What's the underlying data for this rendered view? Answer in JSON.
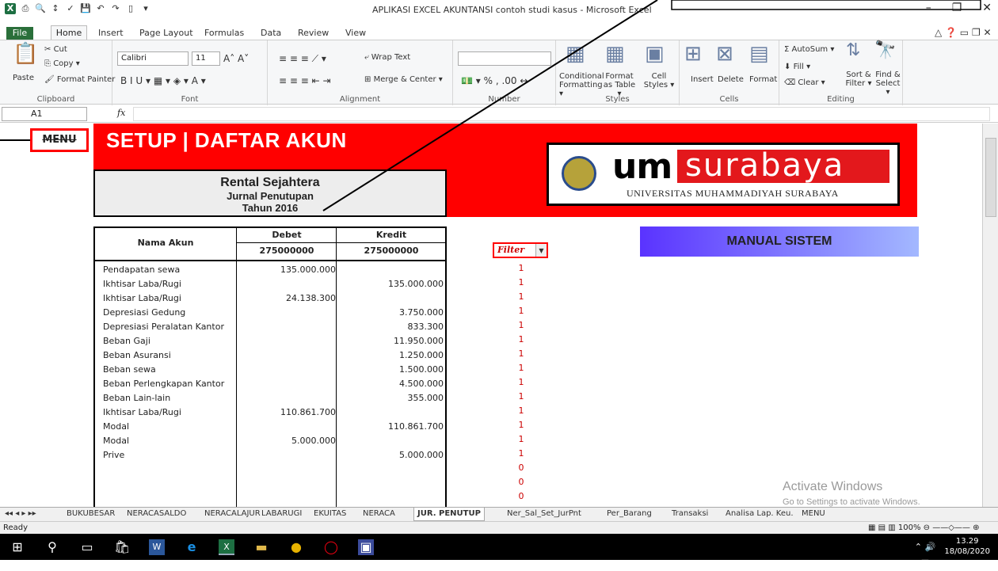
{
  "window": {
    "title": "APLIKASI EXCEL AKUNTANSI contoh studi kasus - Microsoft Excel",
    "controls": [
      "–",
      "❐",
      "✕"
    ]
  },
  "ribbon_tabs": [
    "File",
    "Home",
    "Insert",
    "Page Layout",
    "Formulas",
    "Data",
    "Review",
    "View"
  ],
  "ribbon": {
    "clipboard": {
      "paste": "Paste",
      "cut": "Cut",
      "copy": "Copy ▾",
      "format_painter": "Format Painter",
      "label": "Clipboard"
    },
    "font": {
      "name": "Calibri",
      "size": "11",
      "label": "Font"
    },
    "alignment": {
      "wrap": "Wrap Text",
      "merge": "Merge & Center ▾",
      "label": "Alignment"
    },
    "number": {
      "label": "Number",
      "percent": "%"
    },
    "styles": {
      "conditional": "Conditional Formatting ▾",
      "format_table": "Format as Table ▾",
      "cell_styles": "Cell Styles ▾",
      "label": "Styles"
    },
    "cells": {
      "insert": "Insert",
      "delete": "Delete",
      "format": "Format",
      "label": "Cells"
    },
    "editing": {
      "autosum": "Σ AutoSum ▾",
      "fill": "Fill ▾",
      "clear": "Clear ▾",
      "sort": "Sort & Filter ▾",
      "find": "Find & Select ▾",
      "label": "Editing"
    }
  },
  "formula_bar": {
    "cell_ref": "A1",
    "fx": "fx",
    "content": ""
  },
  "sheet": {
    "menu_button": "MENU",
    "title": "SETUP | DAFTAR AKUN",
    "company": "Rental Sejahtera",
    "subtitle": "Jurnal Penutupan",
    "year": "Tahun 2016",
    "logo": {
      "um": "um",
      "surabaya": "surabaya",
      "university": "UNIVERSITAS MUHAMMADIYAH SURABAYA"
    },
    "manual_button": "MANUAL SISTEM",
    "filter_label": "Filter",
    "table": {
      "col_name": "Nama Akun",
      "col_debet": "Debet",
      "col_kredit": "Kredit",
      "total_debet": "275000000",
      "total_kredit": "275000000",
      "rows": [
        {
          "name": "Pendapatan sewa",
          "debet": "135.000.000",
          "kredit": "",
          "filter": "1"
        },
        {
          "name": "Ikhtisar Laba/Rugi",
          "debet": "",
          "kredit": "135.000.000",
          "filter": "1"
        },
        {
          "name": "Ikhtisar Laba/Rugi",
          "debet": "24.138.300",
          "kredit": "",
          "filter": "1"
        },
        {
          "name": "Depresiasi Gedung",
          "debet": "",
          "kredit": "3.750.000",
          "filter": "1"
        },
        {
          "name": "Depresiasi Peralatan Kantor",
          "debet": "",
          "kredit": "833.300",
          "filter": "1"
        },
        {
          "name": "Beban Gaji",
          "debet": "",
          "kredit": "11.950.000",
          "filter": "1"
        },
        {
          "name": "Beban Asuransi",
          "debet": "",
          "kredit": "1.250.000",
          "filter": "1"
        },
        {
          "name": "Beban sewa",
          "debet": "",
          "kredit": "1.500.000",
          "filter": "1"
        },
        {
          "name": "Beban Perlengkapan Kantor",
          "debet": "",
          "kredit": "4.500.000",
          "filter": "1"
        },
        {
          "name": "Beban Lain-lain",
          "debet": "",
          "kredit": "355.000",
          "filter": "1"
        },
        {
          "name": "Ikhtisar Laba/Rugi",
          "debet": "110.861.700",
          "kredit": "",
          "filter": "1"
        },
        {
          "name": "Modal",
          "debet": "",
          "kredit": "110.861.700",
          "filter": "1"
        },
        {
          "name": "Modal",
          "debet": "5.000.000",
          "kredit": "",
          "filter": "1"
        },
        {
          "name": "Prive",
          "debet": "",
          "kredit": "5.000.000",
          "filter": "1"
        },
        {
          "name": "",
          "debet": "",
          "kredit": "",
          "filter": "0"
        },
        {
          "name": "",
          "debet": "",
          "kredit": "",
          "filter": "0"
        },
        {
          "name": "",
          "debet": "",
          "kredit": "",
          "filter": "0"
        }
      ]
    },
    "watermark": {
      "line1": "Activate Windows",
      "line2": "Go to Settings to activate Windows."
    }
  },
  "sheet_tabs": [
    "BUKUBESAR",
    "NERACASALDO",
    "NERACALAJUR",
    "LABARUGI",
    "EKUITAS",
    "NERACA",
    "JUR. PENUTUP",
    "Ner_Sal_Set_JurPnt",
    "Per_Barang",
    "Transaksi",
    "Analisa Lap. Keu.",
    "MENU"
  ],
  "active_sheet": "JUR. PENUTUP",
  "status": {
    "ready": "Ready",
    "zoom": "100%"
  },
  "clock": {
    "time": "13.29",
    "date": "18/08/2020"
  }
}
